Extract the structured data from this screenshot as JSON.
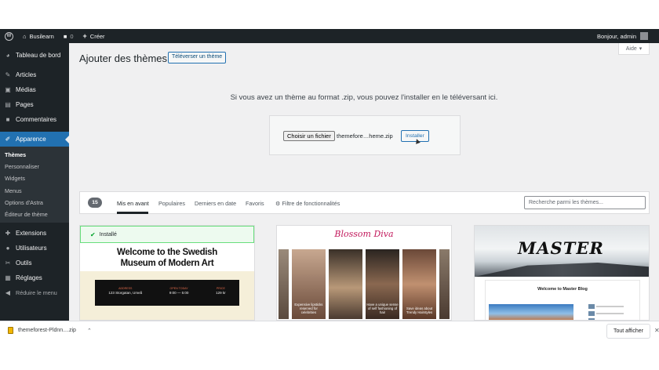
{
  "adminbar": {
    "site_name": "Busilearn",
    "comments_count": "0",
    "new_label": "Créer",
    "greeting": "Bonjour, admin"
  },
  "sidebar": {
    "dashboard": "Tableau de bord",
    "posts": "Articles",
    "media": "Médias",
    "pages": "Pages",
    "comments": "Commentaires",
    "appearance": "Apparence",
    "submenu": [
      "Thèmes",
      "Personnaliser",
      "Widgets",
      "Menus",
      "Options d'Astra",
      "Éditeur de thème"
    ],
    "plugins": "Extensions",
    "users": "Utilisateurs",
    "tools": "Outils",
    "settings": "Réglages",
    "collapse": "Réduire le menu"
  },
  "main": {
    "title": "Ajouter des thèmes",
    "upload_button": "Téléverser un thème",
    "help": "Aide",
    "upload_text": "Si vous avez un thème au format .zip, vous pouvez l'installer en le téléversant ici.",
    "file_button": "Choisir un fichier",
    "file_name": "themefore…heme.zip",
    "install_button": "Installer"
  },
  "filter": {
    "count": "15",
    "tabs": [
      "Mis en avant",
      "Populaires",
      "Derniers en date",
      "Favoris"
    ],
    "feature_filter": "Filtre de fonctionnalités",
    "search_placeholder": "Recherche parmi les thèmes..."
  },
  "themes": {
    "swedish": {
      "installed": "Installé",
      "heading_line1": "Welcome to the Swedish",
      "heading_line2": "Museum of Modern Art",
      "cols": [
        {
          "label": "ADDRESS",
          "value": "123 Storgatan, Umeå"
        },
        {
          "label": "OPEN TODAY",
          "value": "9:00 — 5:00"
        },
        {
          "label": "PRICE",
          "value": "129 kr"
        }
      ]
    },
    "diva": {
      "logo": "Blossom Diva",
      "captions": [
        "Expensive lipsticks reserved for celebrities",
        "",
        "Have a unique sense of self fashioning of hair",
        "Save ideas about Trendy Hairstyles",
        ""
      ]
    },
    "master": {
      "logo": "MASTER",
      "blog_title": "Welcome to Master Blog"
    }
  },
  "downloads": {
    "file": "themeforest-Pldnn....zip",
    "show_all": "Tout afficher"
  },
  "colors": {
    "accent": "#2271b1",
    "adminbar": "#1d2327",
    "installed_green": "#00a32a"
  }
}
